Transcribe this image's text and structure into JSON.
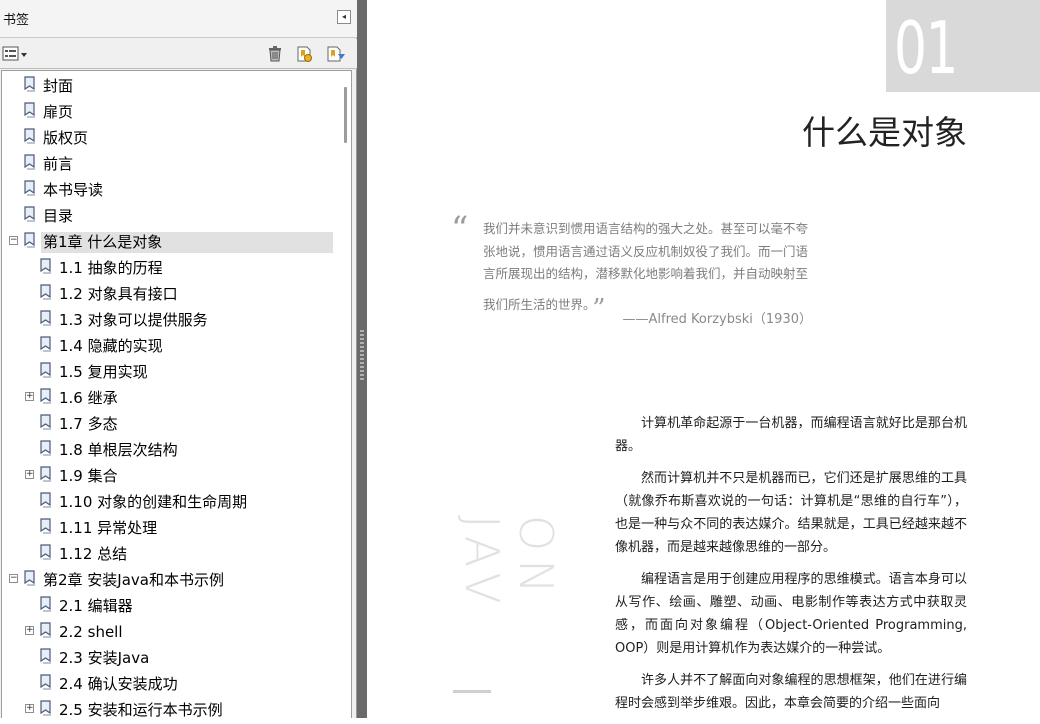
{
  "panel": {
    "title": "书签",
    "collapse_glyph": "◂",
    "toolbar": {
      "options_icon": "options-menu-icon",
      "delete_icon": "trash-icon",
      "new_icon": "new-bookmark-icon",
      "properties_icon": "bookmark-properties-icon"
    },
    "items": [
      {
        "label": "封面",
        "level": 0,
        "expandable": false
      },
      {
        "label": "扉页",
        "level": 0,
        "expandable": false
      },
      {
        "label": "版权页",
        "level": 0,
        "expandable": false
      },
      {
        "label": "前言",
        "level": 0,
        "expandable": false
      },
      {
        "label": "本书导读",
        "level": 0,
        "expandable": false
      },
      {
        "label": "目录",
        "level": 0,
        "expandable": false
      },
      {
        "label": "第1章 什么是对象",
        "level": 0,
        "expandable": true,
        "expanded": true,
        "selected": true
      },
      {
        "label": "1.1 抽象的历程",
        "level": 1,
        "expandable": false
      },
      {
        "label": "1.2 对象具有接口",
        "level": 1,
        "expandable": false
      },
      {
        "label": "1.3 对象可以提供服务",
        "level": 1,
        "expandable": false
      },
      {
        "label": "1.4 隐藏的实现",
        "level": 1,
        "expandable": false
      },
      {
        "label": "1.5 复用实现",
        "level": 1,
        "expandable": false
      },
      {
        "label": "1.6 继承",
        "level": 1,
        "expandable": true,
        "expanded": false
      },
      {
        "label": "1.7 多态",
        "level": 1,
        "expandable": false
      },
      {
        "label": "1.8 单根层次结构",
        "level": 1,
        "expandable": false
      },
      {
        "label": "1.9 集合",
        "level": 1,
        "expandable": true,
        "expanded": false
      },
      {
        "label": "1.10 对象的创建和生命周期",
        "level": 1,
        "expandable": false
      },
      {
        "label": "1.11 异常处理",
        "level": 1,
        "expandable": false
      },
      {
        "label": "1.12 总结",
        "level": 1,
        "expandable": false
      },
      {
        "label": "第2章 安装Java和本书示例",
        "level": 0,
        "expandable": true,
        "expanded": true
      },
      {
        "label": "2.1 编辑器",
        "level": 1,
        "expandable": false
      },
      {
        "label": "2.2 shell",
        "level": 1,
        "expandable": true,
        "expanded": false
      },
      {
        "label": "2.3 安装Java",
        "level": 1,
        "expandable": false
      },
      {
        "label": "2.4 确认安装成功",
        "level": 1,
        "expandable": false
      },
      {
        "label": "2.5 安装和运行本书示例",
        "level": 1,
        "expandable": true,
        "expanded": false
      }
    ]
  },
  "page": {
    "chapter_number": "01",
    "chapter_title": "什么是对象",
    "quote": "我们并未意识到惯用语言结构的强大之处。甚至可以毫不夸张地说，惯用语言通过语义反应机制奴役了我们。而一门语言所展现出的结构，潜移默化地影响着我们，并自动映射至我们所生活的世界。",
    "quote_author": "——Alfred Korzybski（1930）",
    "side_watermark": "ON JAV",
    "paragraphs": [
      "计算机革命起源于一台机器，而编程语言就好比是那台机器。",
      "然而计算机并不只是机器而已，它们还是扩展思维的工具（就像乔布斯喜欢说的一句话：计算机是“思维的自行车”），也是一种与众不同的表达媒介。结果就是，工具已经越来越不像机器，而是越来越像思维的一部分。",
      "编程语言是用于创建应用程序的思维模式。语言本身可以从写作、绘画、雕塑、动画、电影制作等表达方式中获取灵感，而面向对象编程（Object-Oriented Programming, OOP）则是用计算机作为表达媒介的一种尝试。",
      "许多人并不了解面向对象编程的思想框架，他们在进行编程时会感到举步维艰。因此，本章会简要的介绍一些面向"
    ]
  }
}
